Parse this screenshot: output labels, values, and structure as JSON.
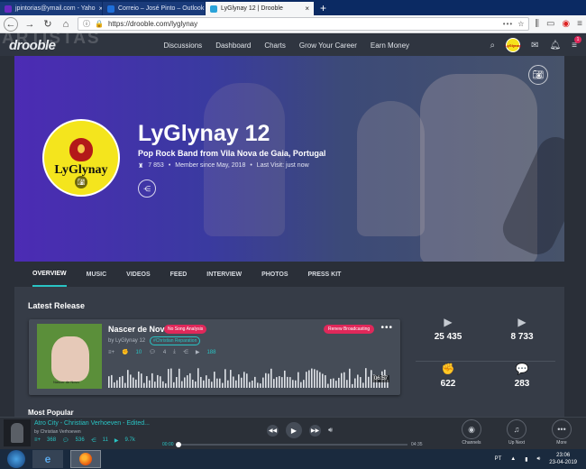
{
  "browser": {
    "tabs": [
      {
        "label": "jpintorias@ymail.com - Yaho",
        "color": "#6a2bc2",
        "active": false
      },
      {
        "label": "Correio – José Pinto – Outlook",
        "color": "#1e6fd9",
        "active": false
      },
      {
        "label": "LyGlynay 12 | Drooble",
        "color": "#2aa3d9",
        "active": true
      }
    ],
    "url": "https://drooble.com/lyglynay",
    "new_tab": "+",
    "tab_close": "×"
  },
  "watermark": "ARTISTAS",
  "site": {
    "logo": "drooble",
    "nav": [
      "Discussions",
      "Dashboard",
      "Charts",
      "Grow Your Career",
      "Earn Money"
    ],
    "mini_avatar_text": "LyGlynay",
    "notification_count": "1"
  },
  "profile": {
    "name": "LyGlynay 12",
    "description": "Pop Rock Band from Vila Nova de Gaia, Portugal",
    "rank": "7 853",
    "member_since": "Member since May, 2018",
    "last_visit": "Last Visit: just now",
    "avatar_text": "LyGlynay",
    "tabs": [
      "OVERVIEW",
      "MUSIC",
      "VIDEOS",
      "FEED",
      "INTERVIEW",
      "PHOTOS",
      "PRESS KIT"
    ]
  },
  "release": {
    "section_title": "Latest Release",
    "title": "Nascer de Novo",
    "no_analysis_badge": "No Song Analysis",
    "renew_label": "Renew Broadcasting",
    "by": "by LyGlynay 12",
    "genre": "#Christian Reparation",
    "cover_text": "Nascer de Novo",
    "likes": "10",
    "comments": "4",
    "plays": "188",
    "duration": "06:57",
    "more": "•••"
  },
  "most_popular": "Most Popular",
  "stats": [
    {
      "icon": "play-icon",
      "glyph": "▶",
      "value": "25 435"
    },
    {
      "icon": "youtube-icon",
      "glyph": "▶",
      "value": "8 733"
    },
    {
      "icon": "fist-icon",
      "glyph": "✊",
      "value": "622"
    },
    {
      "icon": "chat-icon",
      "glyph": "💬",
      "value": "283"
    }
  ],
  "player": {
    "title": "Atro City - Christian Verhoeven - Edited...",
    "artist": "by Christian Verhoeven",
    "plays": "368",
    "comments": "536",
    "shares": "11",
    "views": "9.7k",
    "time_current": "00:00",
    "time_total": "04:35",
    "progress": 0,
    "right_buttons": [
      {
        "icon": "channels-icon",
        "glyph": "◉",
        "label": "Channels"
      },
      {
        "icon": "up-next-icon",
        "glyph": "♫",
        "label": "Up Next"
      },
      {
        "icon": "more-icon",
        "glyph": "•••",
        "label": "More"
      }
    ]
  },
  "taskbar": {
    "lang": "PT",
    "time": "23:06",
    "date": "23-04-2019"
  },
  "colors": {
    "accent": "#29c4c4",
    "alert": "#e0285a",
    "hero_start": "#4c2bb4"
  }
}
